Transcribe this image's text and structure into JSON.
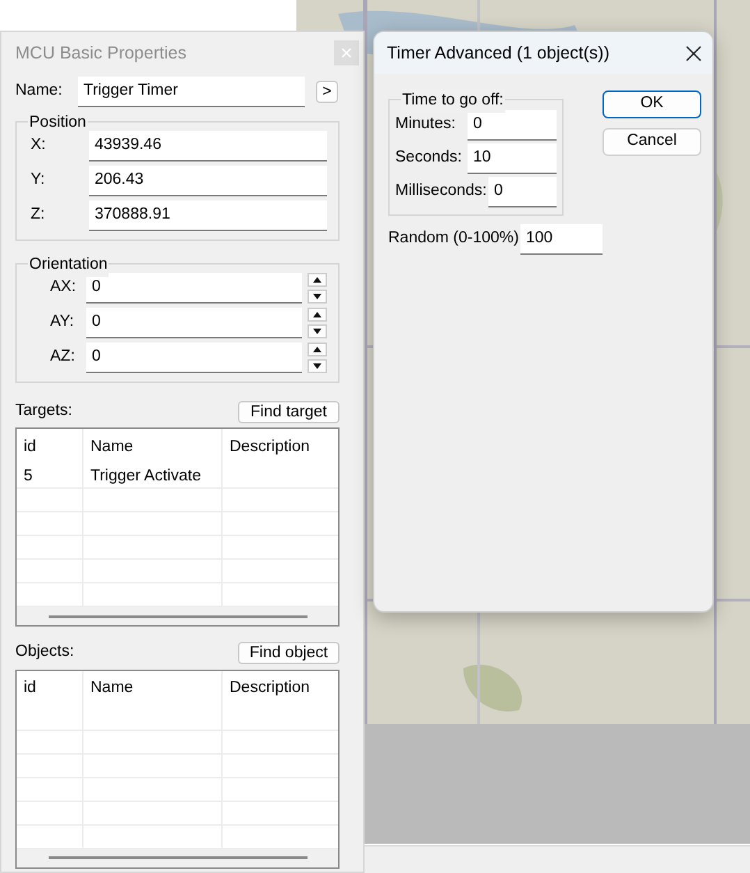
{
  "props_window": {
    "title": "MCU Basic Properties",
    "name_label": "Name:",
    "name_value": "Trigger Timer",
    "name_button": ">",
    "position": {
      "legend": "Position",
      "fields": [
        {
          "label": "X:",
          "value": "43939.46"
        },
        {
          "label": "Y:",
          "value": "206.43"
        },
        {
          "label": "Z:",
          "value": "370888.91"
        }
      ]
    },
    "orientation": {
      "legend": "Orientation",
      "fields": [
        {
          "label": "AX:",
          "value": "0"
        },
        {
          "label": "AY:",
          "value": "0"
        },
        {
          "label": "AZ:",
          "value": "0"
        }
      ]
    },
    "lists": [
      {
        "label": "Targets:",
        "button": "Find target",
        "columns": [
          "id",
          "Name",
          "Description"
        ],
        "rows": [
          [
            "5",
            "Trigger Activate",
            ""
          ]
        ]
      },
      {
        "label": "Objects:",
        "button": "Find object",
        "columns": [
          "id",
          "Name",
          "Description"
        ]
      }
    ]
  },
  "timer_window": {
    "title": "Timer Advanced (1 object(s))",
    "group_legend": "Time to go off:",
    "fields": [
      {
        "label": "Minutes:",
        "value": "0"
      },
      {
        "label": "Seconds:",
        "value": "10"
      },
      {
        "label": "Milliseconds:",
        "value": "0"
      }
    ],
    "random": {
      "label": "Random (0-100%)",
      "value": "100"
    },
    "buttons": [
      {
        "label": "OK",
        "default": true
      },
      {
        "label": "Cancel",
        "default": false
      }
    ]
  }
}
